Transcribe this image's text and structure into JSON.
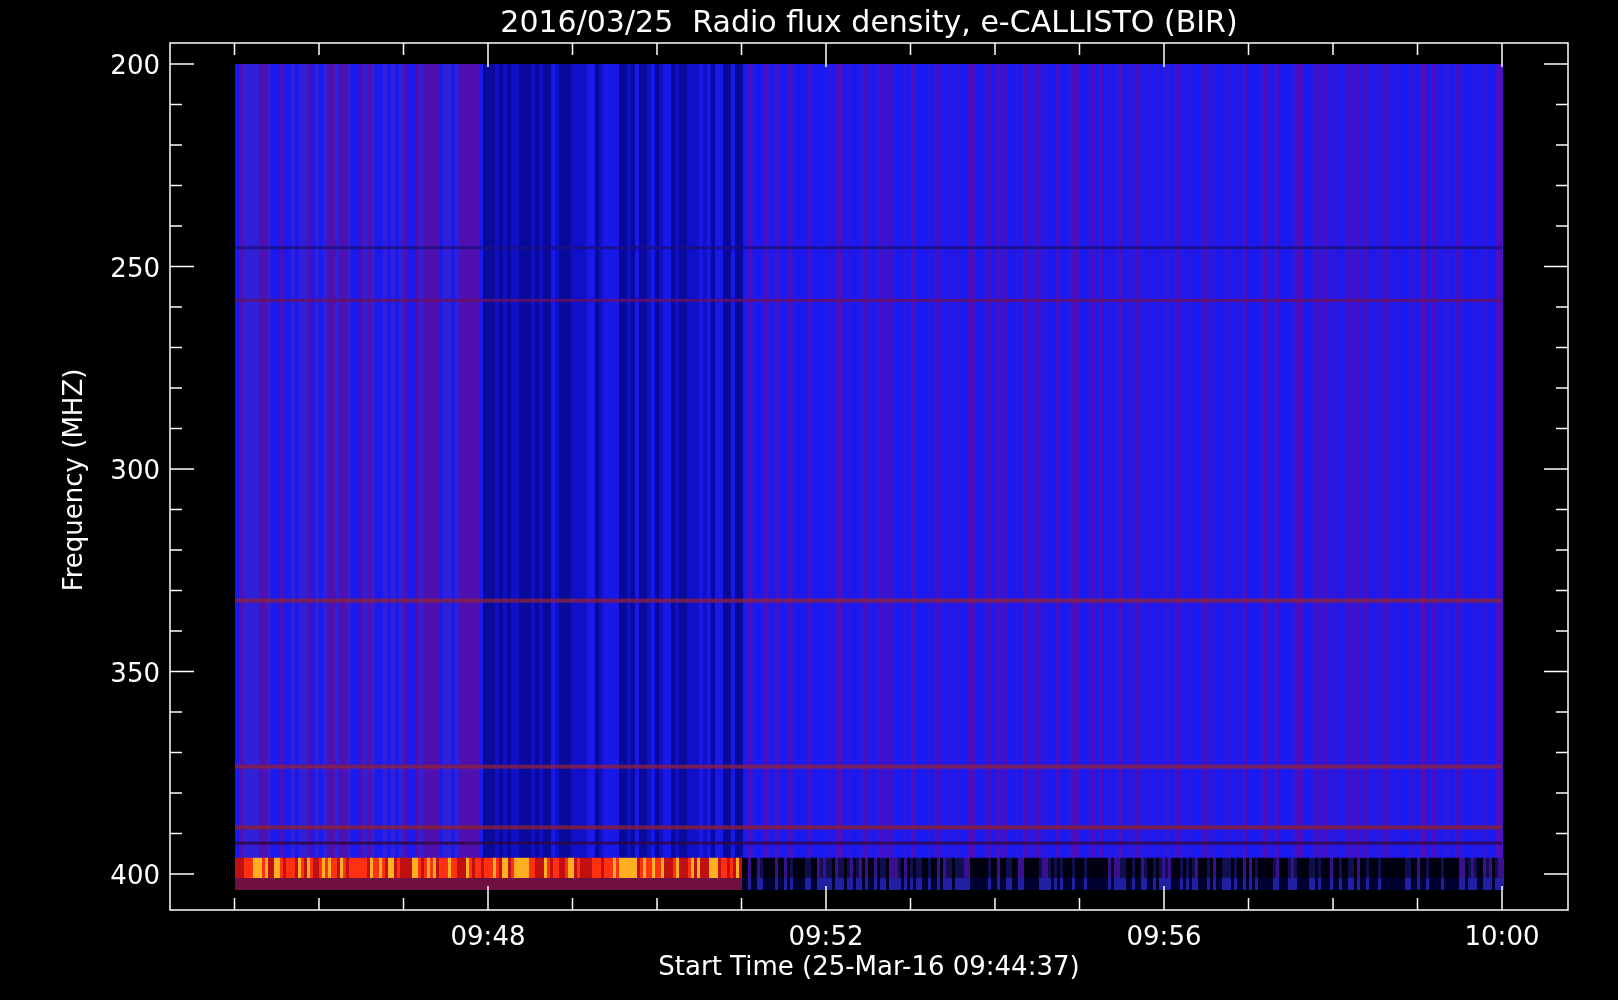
{
  "plot": {
    "title": "2016/03/25  Radio flux density, e-CALLISTO (BIR)",
    "y_axis": {
      "label": "Frequency (MHZ)",
      "ticks": [
        "200",
        "250",
        "300",
        "350",
        "400"
      ]
    },
    "x_axis": {
      "label": "Start Time (25-Mar-16 09:44:37)",
      "ticks": [
        "09:48",
        "09:52",
        "09:56",
        "10:00"
      ]
    }
  }
}
